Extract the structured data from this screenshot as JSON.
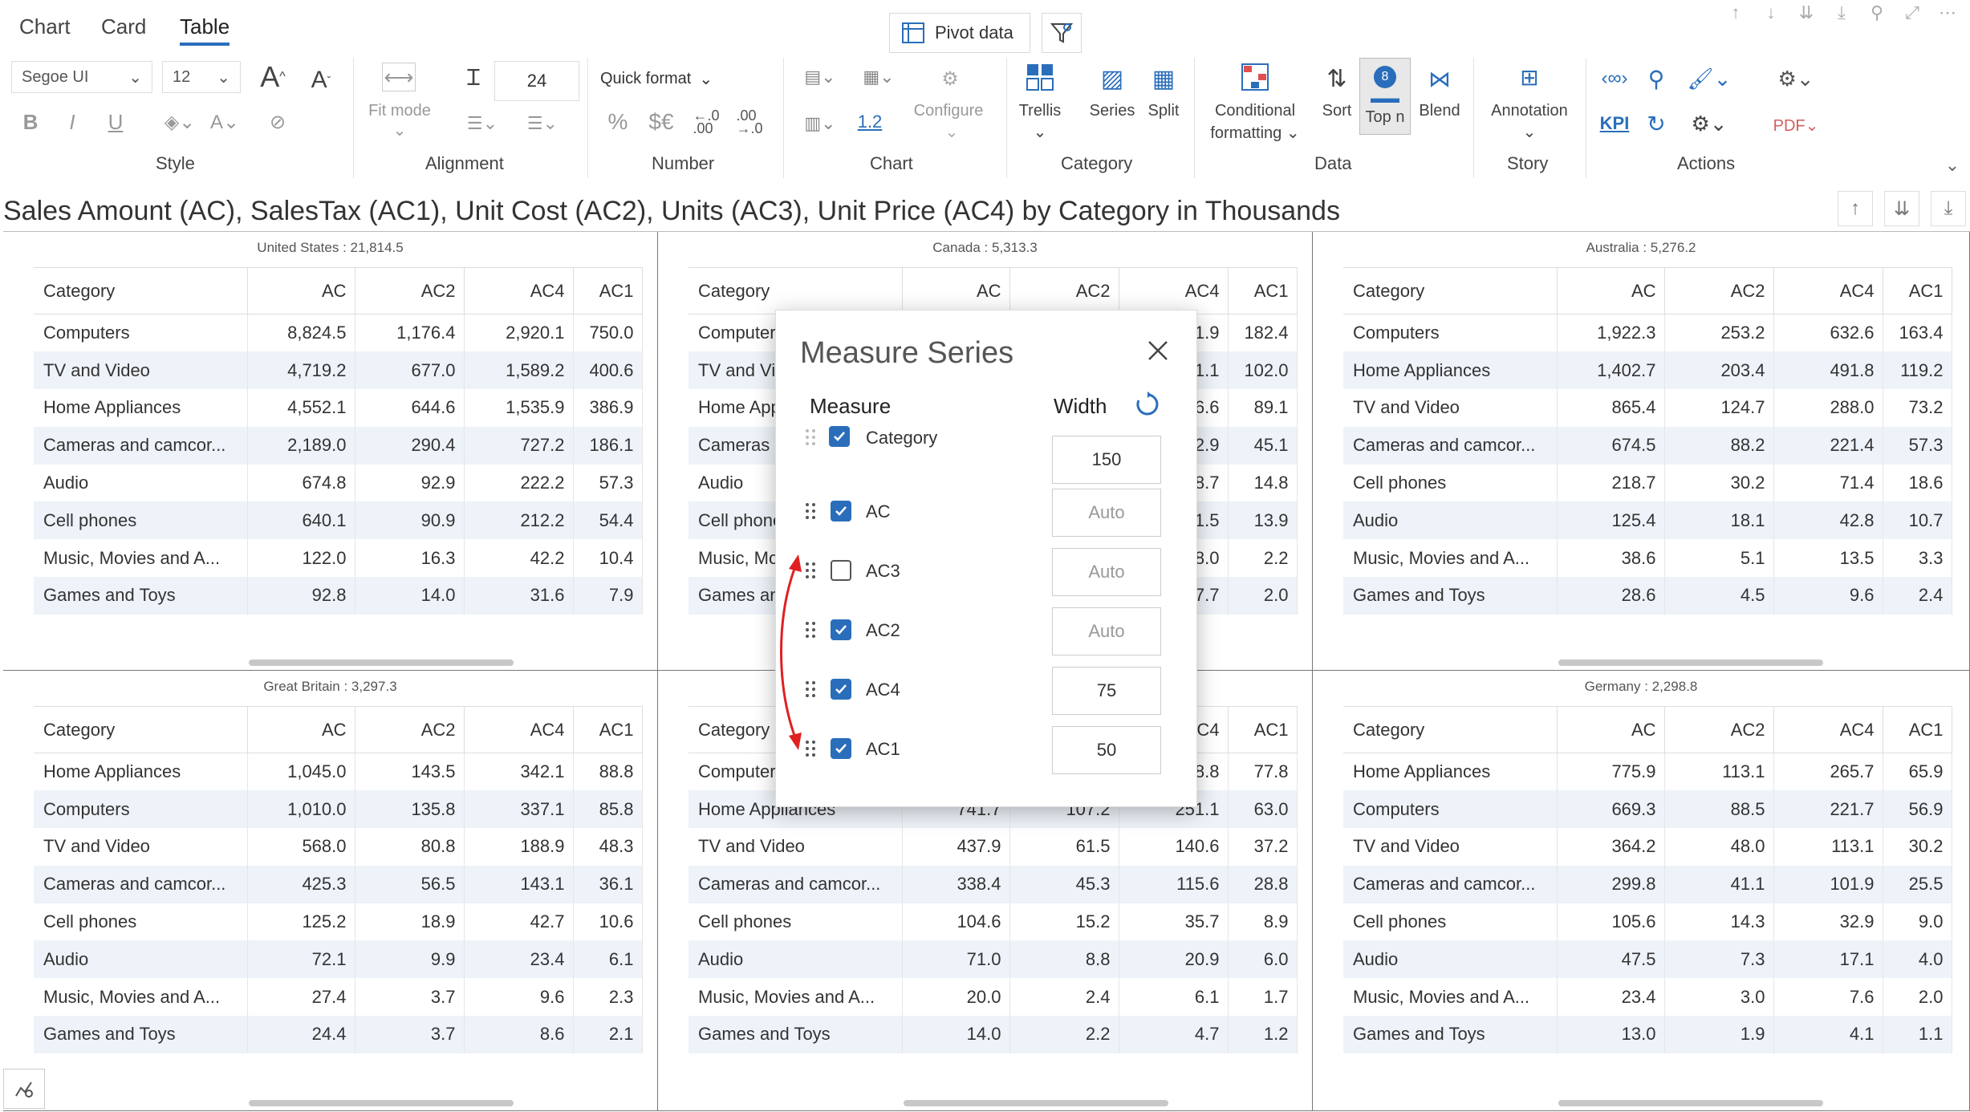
{
  "tabs": [
    "Chart",
    "Card",
    "Table"
  ],
  "pivot_label": "Pivot data",
  "ribbon": {
    "font_name": "Segoe UI",
    "font_size": "12",
    "fit_mode": "Fit mode",
    "row_height": "24",
    "quick_format": "Quick format",
    "pct_symbol": "%",
    "currency_symbol": "$€",
    "dec_inc": ".0 .00",
    "dec_dec": ".00 .0",
    "decimal_value": "1.2",
    "configure": "Configure",
    "trellis": "Trellis",
    "series": "Series",
    "split": "Split",
    "conditional_formatting_1": "Conditional",
    "conditional_formatting_2": "formatting",
    "sort": "Sort",
    "top_n": "Top n",
    "top_n_badge": "8",
    "blend": "Blend",
    "annotation": "Annotation",
    "kpi": "KPI",
    "groups": {
      "style": "Style",
      "alignment": "Alignment",
      "number": "Number",
      "chart": "Chart",
      "category": "Category",
      "data": "Data",
      "story": "Story",
      "actions": "Actions"
    }
  },
  "title": "Sales Amount (AC), SalesTax (AC1), Unit Cost (AC2), Units (AC3), Unit Price (AC4) by Category in Thousands",
  "columns": [
    "Category",
    "AC",
    "AC2",
    "AC4",
    "AC1"
  ],
  "panels": [
    {
      "title": "United States :  21,814.5",
      "rows": [
        [
          "Computers",
          "8,824.5",
          "1,176.4",
          "2,920.1",
          "750.0"
        ],
        [
          "TV and Video",
          "4,719.2",
          "677.0",
          "1,589.2",
          "400.6"
        ],
        [
          "Home Appliances",
          "4,552.1",
          "644.6",
          "1,535.9",
          "386.9"
        ],
        [
          "Cameras and camcor...",
          "2,189.0",
          "290.4",
          "727.2",
          "186.1"
        ],
        [
          "Audio",
          "674.8",
          "92.9",
          "222.2",
          "57.3"
        ],
        [
          "Cell phones",
          "640.1",
          "90.9",
          "212.2",
          "54.4"
        ],
        [
          "Music, Movies and A...",
          "122.0",
          "16.3",
          "42.2",
          "10.4"
        ],
        [
          "Games and Toys",
          "92.8",
          "14.0",
          "31.6",
          "7.9"
        ]
      ]
    },
    {
      "title": "Canada :  5,313.3",
      "rows": [
        [
          "Computers",
          "",
          "",
          "21.9",
          "182.4"
        ],
        [
          "TV and Video",
          "",
          "",
          "1.1",
          "102.0"
        ],
        [
          "Home Appliances",
          "",
          "",
          "56.6",
          "89.1"
        ],
        [
          "Cameras and camcor...",
          "",
          "",
          "32.9",
          "45.1"
        ],
        [
          "Audio",
          "",
          "",
          "58.7",
          "14.8"
        ],
        [
          "Cell phones",
          "",
          "",
          "51.5",
          "13.9"
        ],
        [
          "Music, Movies and A...",
          "",
          "",
          "8.0",
          "2.2"
        ],
        [
          "Games and Toys",
          "",
          "",
          "7.7",
          "2.0"
        ]
      ]
    },
    {
      "title": "Australia :  5,276.2",
      "rows": [
        [
          "Computers",
          "1,922.3",
          "253.2",
          "632.6",
          "163.4"
        ],
        [
          "Home Appliances",
          "1,402.7",
          "203.4",
          "491.8",
          "119.2"
        ],
        [
          "TV and Video",
          "865.4",
          "124.7",
          "288.0",
          "73.2"
        ],
        [
          "Cameras and camcor...",
          "674.5",
          "88.2",
          "221.4",
          "57.3"
        ],
        [
          "Cell phones",
          "218.7",
          "30.2",
          "71.4",
          "18.6"
        ],
        [
          "Audio",
          "125.4",
          "18.1",
          "42.8",
          "10.7"
        ],
        [
          "Music, Movies and A...",
          "38.6",
          "5.1",
          "13.5",
          "3.3"
        ],
        [
          "Games and Toys",
          "28.6",
          "4.5",
          "9.6",
          "2.4"
        ]
      ]
    },
    {
      "title": "Great Britain :  3,297.3",
      "rows": [
        [
          "Home Appliances",
          "1,045.0",
          "143.5",
          "342.1",
          "88.8"
        ],
        [
          "Computers",
          "1,010.0",
          "135.8",
          "337.1",
          "85.8"
        ],
        [
          "TV and Video",
          "568.0",
          "80.8",
          "188.9",
          "48.3"
        ],
        [
          "Cameras and camcor...",
          "425.3",
          "56.5",
          "143.1",
          "36.1"
        ],
        [
          "Cell phones",
          "125.2",
          "18.9",
          "42.7",
          "10.6"
        ],
        [
          "Audio",
          "72.1",
          "9.9",
          "23.4",
          "6.1"
        ],
        [
          "Music, Movies and A...",
          "27.4",
          "3.7",
          "9.6",
          "2.3"
        ],
        [
          "Games and Toys",
          "24.4",
          "3.7",
          "8.6",
          "2.1"
        ]
      ]
    },
    {
      "title": "",
      "rows": [
        [
          "Computers",
          "",
          "",
          "98.8",
          "77.8"
        ],
        [
          "Home Appliances",
          "741.7",
          "107.2",
          "251.1",
          "63.0"
        ],
        [
          "TV and Video",
          "437.9",
          "61.5",
          "140.6",
          "37.2"
        ],
        [
          "Cameras and camcor...",
          "338.4",
          "45.3",
          "115.6",
          "28.8"
        ],
        [
          "Cell phones",
          "104.6",
          "15.2",
          "35.7",
          "8.9"
        ],
        [
          "Audio",
          "71.0",
          "8.8",
          "20.9",
          "6.0"
        ],
        [
          "Music, Movies and A...",
          "20.0",
          "2.4",
          "6.1",
          "1.7"
        ],
        [
          "Games and Toys",
          "14.0",
          "2.2",
          "4.7",
          "1.2"
        ]
      ]
    },
    {
      "title": "Germany :  2,298.8",
      "rows": [
        [
          "Home Appliances",
          "775.9",
          "113.1",
          "265.7",
          "65.9"
        ],
        [
          "Computers",
          "669.3",
          "88.5",
          "221.7",
          "56.9"
        ],
        [
          "TV and Video",
          "364.2",
          "48.0",
          "113.1",
          "30.2"
        ],
        [
          "Cameras and camcor...",
          "299.8",
          "41.1",
          "101.9",
          "25.5"
        ],
        [
          "Cell phones",
          "105.6",
          "14.3",
          "32.9",
          "9.0"
        ],
        [
          "Audio",
          "47.5",
          "7.3",
          "17.1",
          "4.0"
        ],
        [
          "Music, Movies and A...",
          "23.4",
          "3.0",
          "7.6",
          "2.0"
        ],
        [
          "Games and Toys",
          "13.0",
          "1.9",
          "4.1",
          "1.1"
        ]
      ]
    }
  ],
  "modal": {
    "title": "Measure Series",
    "measure_header": "Measure",
    "width_header": "Width",
    "rows": [
      {
        "label": "Category",
        "checked": true,
        "width": "150",
        "placeholder": false
      },
      {
        "label": "AC",
        "checked": true,
        "width": "Auto",
        "placeholder": true
      },
      {
        "label": "AC3",
        "checked": false,
        "width": "Auto",
        "placeholder": true
      },
      {
        "label": "AC2",
        "checked": true,
        "width": "Auto",
        "placeholder": true
      },
      {
        "label": "AC4",
        "checked": true,
        "width": "75",
        "placeholder": false
      },
      {
        "label": "AC1",
        "checked": true,
        "width": "50",
        "placeholder": false
      }
    ]
  },
  "colors": {
    "accent": "#2a6ebb",
    "arrow": "#e02020",
    "alt_row": "#eef3f9"
  }
}
